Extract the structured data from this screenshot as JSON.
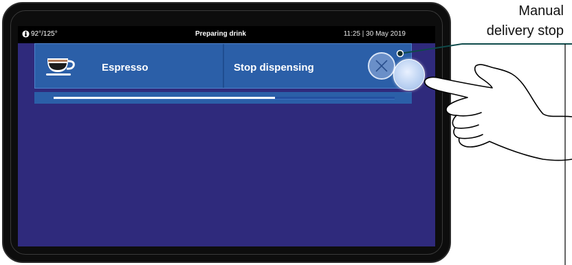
{
  "status_bar": {
    "temperature": "92°/125°",
    "title": "Preparing drink",
    "datetime": "11:25 | 30 May 2019"
  },
  "drink": {
    "name": "Espresso",
    "icon": "espresso-cup-icon"
  },
  "stop": {
    "label": "Stop dispensing",
    "icon": "close-icon"
  },
  "progress": {
    "fraction": 0.65
  },
  "callout": {
    "line1": "Manual",
    "line2": "delivery stop"
  },
  "colors": {
    "screen_bg": "#2f2a7c",
    "panel_bg": "#2b5fa8",
    "status_bar_bg": "#000000"
  }
}
